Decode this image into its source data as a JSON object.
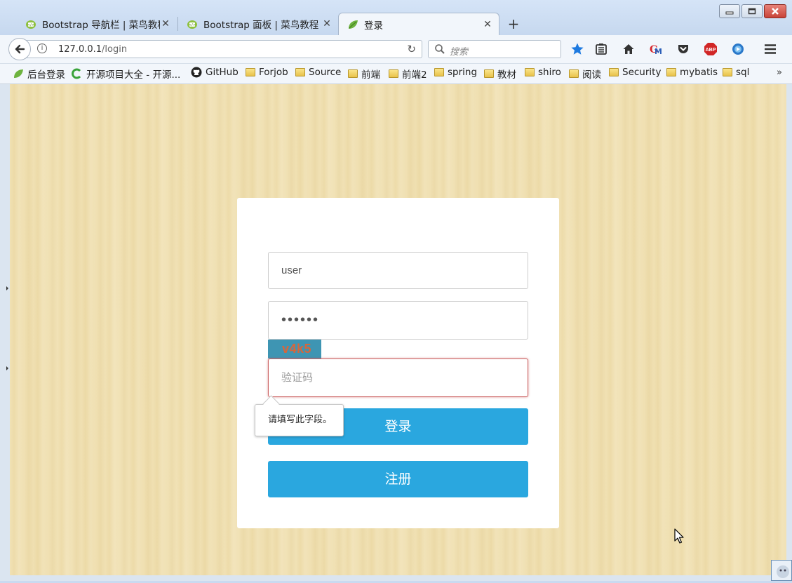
{
  "browser": {
    "tabs": [
      {
        "title": "Bootstrap 导航栏 | 菜鸟教程",
        "favicon": "runoob-icon",
        "active": false
      },
      {
        "title": "Bootstrap 面板 | 菜鸟教程",
        "favicon": "runoob-icon",
        "active": false
      },
      {
        "title": "登录",
        "favicon": "spring-leaf-icon",
        "active": true
      }
    ],
    "new_tab": "+",
    "close_glyph": "✕",
    "url_host": "127.0.0.1",
    "url_path": "/login",
    "search_placeholder": "搜索",
    "toolbar_icons": [
      "bookmark-star-icon",
      "reading-list-icon",
      "home-icon",
      "gm-icon",
      "pocket-icon",
      "adblock-icon",
      "extension-icon",
      "menu-icon"
    ],
    "adblock_label": "ABP"
  },
  "bookmarks": {
    "items": [
      {
        "label": "后台登录",
        "icon": "spring-leaf-icon"
      },
      {
        "label": "开源项目大全 - 开源...",
        "icon": "c-logo-icon"
      },
      {
        "label": "GitHub",
        "icon": "github-icon"
      },
      {
        "label": "Forjob",
        "icon": "folder-icon"
      },
      {
        "label": "Source",
        "icon": "folder-icon"
      },
      {
        "label": "前端",
        "icon": "folder-icon"
      },
      {
        "label": "前端2",
        "icon": "folder-icon"
      },
      {
        "label": "spring",
        "icon": "folder-icon"
      },
      {
        "label": "教材",
        "icon": "folder-icon"
      },
      {
        "label": "shiro",
        "icon": "folder-icon"
      },
      {
        "label": "阅读",
        "icon": "folder-icon"
      },
      {
        "label": "Security",
        "icon": "folder-icon"
      },
      {
        "label": "mybatis",
        "icon": "folder-icon"
      },
      {
        "label": "sql",
        "icon": "folder-icon"
      }
    ],
    "more": "»"
  },
  "login": {
    "username_value": "user",
    "password_mask": "••••••",
    "captcha_text": "v4k5",
    "captcha_placeholder": "验证码",
    "validation_tooltip": "请填写此字段。",
    "login_button": "登录",
    "register_button": "注册"
  },
  "colors": {
    "accent": "#2aa7df",
    "captcha_bg": "#3e95b3",
    "captcha_text": "#d8663a",
    "page_bg": "#f1e2b6"
  }
}
